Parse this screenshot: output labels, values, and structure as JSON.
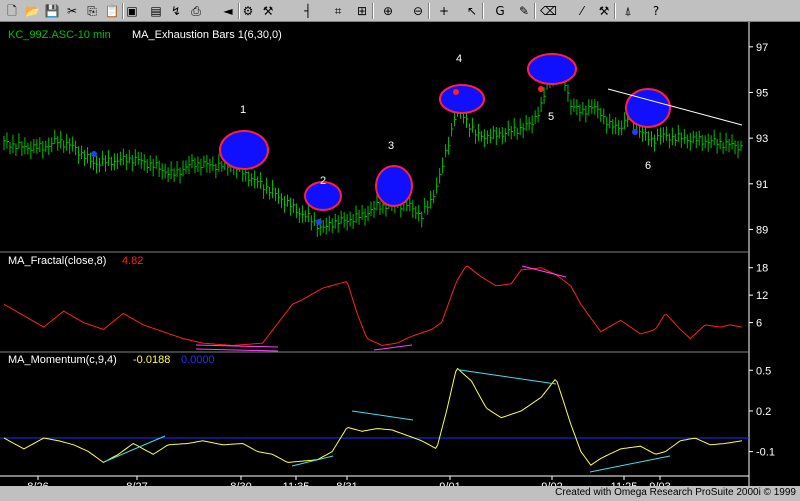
{
  "toolbar": {
    "icons": [
      "new-icon",
      "open-icon",
      "save-icon",
      "cut-icon",
      "copy-icon",
      "paste-icon",
      "window-icon",
      "data-window-icon",
      "indicator-icon",
      "print-icon",
      "scroll-left-icon",
      "format-icon",
      "analysis-icon",
      "bar-icon",
      "insert-indicator-icon",
      "insert-study-icon",
      "zoom-in-icon",
      "zoom-out-icon",
      "crosshair-icon",
      "pointer-icon",
      "text-icon",
      "drawing-icon",
      "eraser-icon",
      "trendline-icon",
      "hammer-icon",
      "chart-icon",
      "help-icon"
    ]
  },
  "colors": {
    "background": "#000000",
    "price_bars": "#00c000",
    "fractal": "#ff2020",
    "momentum": "#ffff40",
    "zero_line": "#2030ff",
    "circle_fill": "#1010ff",
    "circle_stroke": "#ff2040",
    "magenta": "#ff40ff",
    "cyan": "#40e0f0",
    "axis": "#ffffff"
  },
  "chart_data": {
    "type": "line",
    "panels": [
      {
        "name": "price",
        "symbol_label": "KC_99Z.ASC-10 min",
        "indicator_label": "MA_Exhaustion Bars 1(6,30,0)",
        "ylim": [
          88,
          98
        ],
        "yticks": [
          97,
          95,
          93,
          91,
          89
        ],
        "annotations": [
          "1",
          "2",
          "3",
          "4",
          "5",
          "6"
        ],
        "series_points": [
          [
            0,
            92.8
          ],
          [
            20,
            92.6
          ],
          [
            40,
            92.6
          ],
          [
            55,
            92.9
          ],
          [
            70,
            92.6
          ],
          [
            90,
            91.9
          ],
          [
            110,
            92.0
          ],
          [
            130,
            92.1
          ],
          [
            150,
            91.8
          ],
          [
            170,
            91.4
          ],
          [
            190,
            91.9
          ],
          [
            210,
            91.8
          ],
          [
            230,
            91.8
          ],
          [
            250,
            91.2
          ],
          [
            265,
            90.8
          ],
          [
            280,
            90.3
          ],
          [
            295,
            89.8
          ],
          [
            310,
            89.4
          ],
          [
            320,
            89.0
          ],
          [
            330,
            89.3
          ],
          [
            345,
            89.4
          ],
          [
            360,
            89.6
          ],
          [
            375,
            90.0
          ],
          [
            390,
            90.1
          ],
          [
            405,
            90.1
          ],
          [
            420,
            89.6
          ],
          [
            430,
            90.3
          ],
          [
            440,
            91.6
          ],
          [
            448,
            93.0
          ],
          [
            455,
            94.3
          ],
          [
            465,
            93.8
          ],
          [
            475,
            93.1
          ],
          [
            490,
            93.1
          ],
          [
            510,
            93.3
          ],
          [
            530,
            93.6
          ],
          [
            540,
            94.4
          ],
          [
            548,
            95.6
          ],
          [
            560,
            96.0
          ],
          [
            570,
            94.5
          ],
          [
            580,
            94.1
          ],
          [
            590,
            94.4
          ],
          [
            600,
            94.1
          ],
          [
            610,
            93.5
          ],
          [
            620,
            93.5
          ],
          [
            630,
            94.0
          ],
          [
            640,
            93.3
          ],
          [
            650,
            92.9
          ],
          [
            660,
            93.1
          ],
          [
            680,
            93.0
          ],
          [
            700,
            92.9
          ],
          [
            720,
            92.8
          ],
          [
            742,
            92.6
          ]
        ]
      },
      {
        "name": "fractal",
        "label": "MA_Fractal(close,8)",
        "value": "4.82",
        "ylim": [
          0,
          21
        ],
        "yticks": [
          18,
          12,
          6
        ],
        "series_points": [
          [
            0,
            10.0
          ],
          [
            20,
            7.5
          ],
          [
            40,
            5.0
          ],
          [
            60,
            8.5
          ],
          [
            80,
            6.0
          ],
          [
            100,
            4.5
          ],
          [
            120,
            8.0
          ],
          [
            140,
            5.5
          ],
          [
            160,
            4.0
          ],
          [
            180,
            2.5
          ],
          [
            200,
            1.5
          ],
          [
            230,
            1.0
          ],
          [
            260,
            1.5
          ],
          [
            290,
            10.0
          ],
          [
            300,
            11.0
          ],
          [
            320,
            13.5
          ],
          [
            345,
            15.0
          ],
          [
            355,
            8.0
          ],
          [
            365,
            2.5
          ],
          [
            380,
            1.0
          ],
          [
            395,
            1.5
          ],
          [
            410,
            3.0
          ],
          [
            430,
            4.5
          ],
          [
            440,
            6.0
          ],
          [
            455,
            15.0
          ],
          [
            465,
            18.5
          ],
          [
            480,
            16.0
          ],
          [
            495,
            14.0
          ],
          [
            510,
            14.5
          ],
          [
            520,
            17.5
          ],
          [
            540,
            18.0
          ],
          [
            555,
            16.5
          ],
          [
            570,
            14.0
          ],
          [
            580,
            10.0
          ],
          [
            590,
            7.0
          ],
          [
            600,
            4.0
          ],
          [
            620,
            6.5
          ],
          [
            640,
            3.5
          ],
          [
            655,
            4.5
          ],
          [
            665,
            8.0
          ],
          [
            680,
            4.5
          ],
          [
            690,
            2.5
          ],
          [
            705,
            5.5
          ],
          [
            720,
            5.0
          ],
          [
            730,
            5.5
          ],
          [
            742,
            5.0
          ]
        ]
      },
      {
        "name": "momentum",
        "label": "MA_Momentum(c,9,4)",
        "value": "-0.0188",
        "value2": "0.0000",
        "ylim": [
          -0.28,
          0.62
        ],
        "yticks": [
          "0.5",
          "0.2",
          "-0.1"
        ],
        "series_points": [
          [
            0,
            0.0
          ],
          [
            20,
            -0.08
          ],
          [
            40,
            0.0
          ],
          [
            55,
            -0.02
          ],
          [
            70,
            -0.05
          ],
          [
            85,
            -0.1
          ],
          [
            100,
            -0.18
          ],
          [
            115,
            -0.12
          ],
          [
            130,
            -0.04
          ],
          [
            150,
            -0.12
          ],
          [
            165,
            -0.05
          ],
          [
            185,
            -0.04
          ],
          [
            200,
            -0.02
          ],
          [
            220,
            -0.05
          ],
          [
            240,
            -0.04
          ],
          [
            255,
            -0.1
          ],
          [
            270,
            -0.12
          ],
          [
            285,
            -0.18
          ],
          [
            300,
            -0.17
          ],
          [
            315,
            -0.16
          ],
          [
            330,
            -0.1
          ],
          [
            345,
            0.08
          ],
          [
            360,
            0.05
          ],
          [
            375,
            0.07
          ],
          [
            390,
            0.06
          ],
          [
            405,
            0.02
          ],
          [
            420,
            -0.02
          ],
          [
            435,
            -0.08
          ],
          [
            445,
            0.2
          ],
          [
            455,
            0.52
          ],
          [
            470,
            0.42
          ],
          [
            485,
            0.22
          ],
          [
            500,
            0.15
          ],
          [
            520,
            0.2
          ],
          [
            540,
            0.3
          ],
          [
            555,
            0.44
          ],
          [
            570,
            0.1
          ],
          [
            580,
            -0.1
          ],
          [
            590,
            -0.2
          ],
          [
            600,
            -0.15
          ],
          [
            620,
            -0.08
          ],
          [
            640,
            -0.06
          ],
          [
            655,
            -0.12
          ],
          [
            665,
            -0.1
          ],
          [
            680,
            -0.02
          ],
          [
            695,
            0.0
          ],
          [
            710,
            -0.05
          ],
          [
            725,
            -0.04
          ],
          [
            742,
            -0.02
          ]
        ]
      }
    ],
    "x_labels": [
      "8/26",
      "8/27",
      "8/30",
      "11:35",
      "8/31",
      "9/01",
      "9/02",
      "11:25",
      "9/03"
    ],
    "x_axis": {
      "xlim": [
        0,
        742
      ]
    },
    "credit": "Created with Omega Research ProSuite 2000i © 1999"
  }
}
